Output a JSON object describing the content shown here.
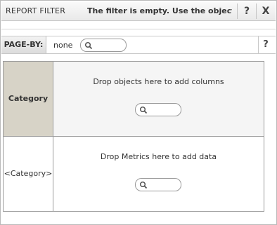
{
  "filter": {
    "title": "REPORT FILTER",
    "message": "The filter is empty. Use the object",
    "help_label": "?",
    "close_label": "X"
  },
  "page_by": {
    "label": "PAGE-BY:",
    "value": "none",
    "search_placeholder": "",
    "help_label": "?"
  },
  "grid": {
    "column_header": "Category",
    "row_header": "<Category>",
    "columns_drop_text": "Drop objects here to add columns",
    "data_drop_text": "Drop Metrics here to add data",
    "columns_search_placeholder": "",
    "data_search_placeholder": ""
  }
}
